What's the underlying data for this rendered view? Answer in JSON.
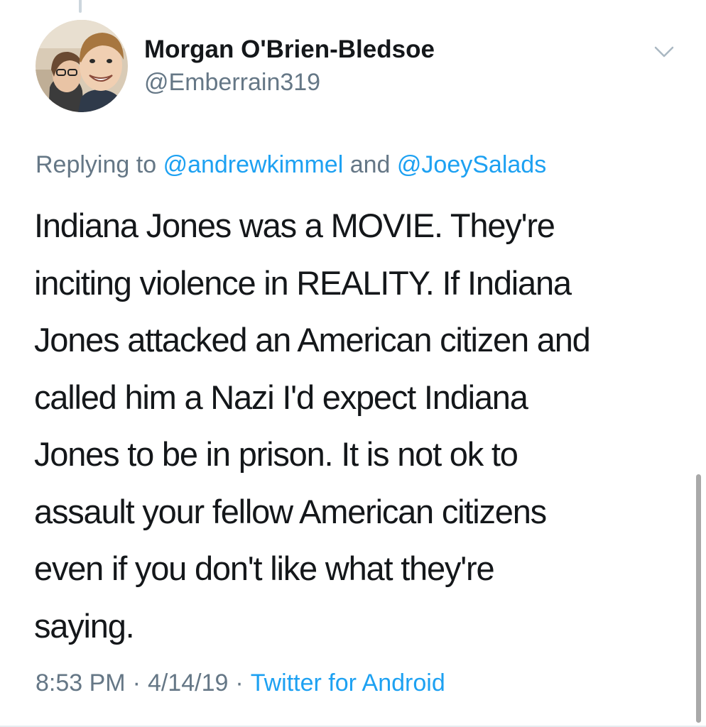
{
  "tweet": {
    "author": {
      "display_name": "Morgan O'Brien-Bledsoe",
      "handle": "@Emberrain319"
    },
    "reply_to": {
      "prefix": "Replying to",
      "mentions": [
        "@andrewkimmel",
        "@JoeySalads"
      ],
      "conjunction": "and"
    },
    "text": "Indiana Jones was a MOVIE. They're\ninciting violence in REALITY. If Indiana\nJones attacked an American citizen and\ncalled him a Nazi I'd expect Indiana\nJones to be in prison. It is not ok to\nassault your fellow American citizens\neven if you don't like what they're\nsaying.",
    "time": "8:53 PM",
    "date": "4/14/19",
    "separator": "·",
    "source": "Twitter for Android"
  },
  "icons": {
    "menu": "chevron-down-icon",
    "avatar": "profile-photo"
  },
  "colors": {
    "link": "#1da1f2",
    "secondary_text": "#657786",
    "primary_text": "#14171a",
    "background": "#ffffff"
  }
}
